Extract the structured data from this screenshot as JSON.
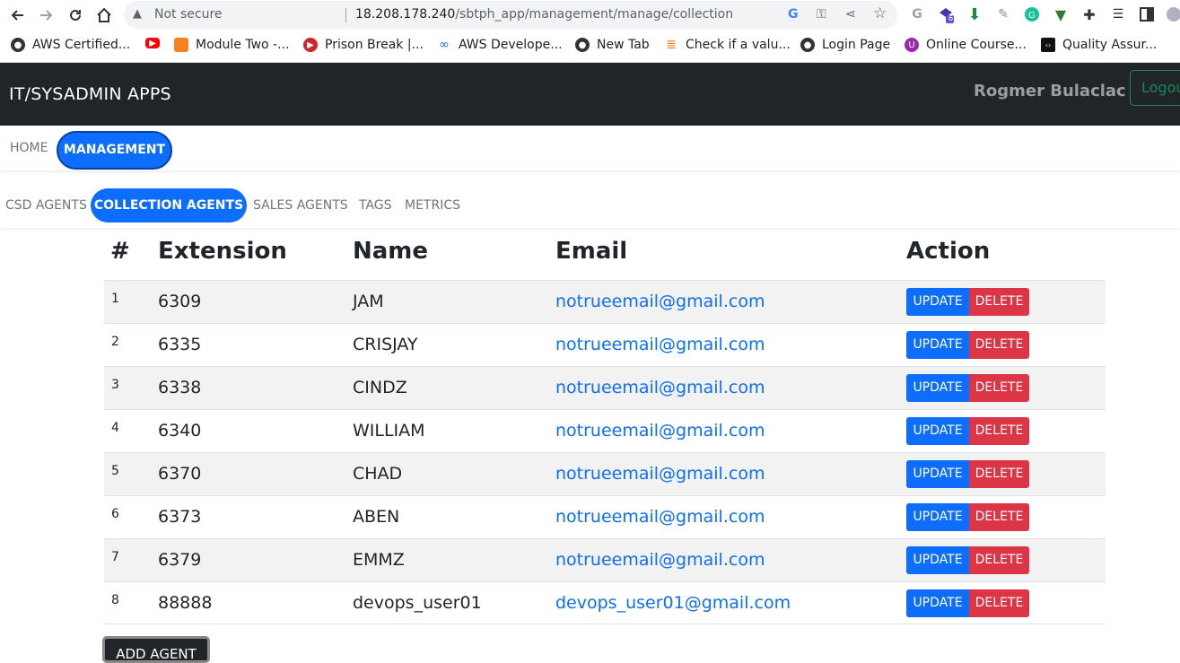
{
  "browser": {
    "security_label": "Not secure",
    "url_host": "18.208.178.240",
    "url_path": "/sbtph_app/management/manage/collection",
    "ext_badge": "6",
    "bookmarks": [
      {
        "label": "AWS Certified...",
        "color": "#333333"
      },
      {
        "label": "",
        "color": "#ff0000"
      },
      {
        "label": "Module Two -...",
        "color": "#f5821f"
      },
      {
        "label": "Prison Break |...",
        "color": "#d3242a"
      },
      {
        "label": "AWS Develope...",
        "color": "#1f6fb8"
      },
      {
        "label": "New Tab",
        "color": "#333333"
      },
      {
        "label": "Check if a valu...",
        "color": "#f48024"
      },
      {
        "label": "Login Page",
        "color": "#333333"
      },
      {
        "label": "Online Course...",
        "color": "#9c27b0"
      },
      {
        "label": "Quality Assur...",
        "color": "#111111"
      }
    ]
  },
  "app": {
    "brand": "IT/SYSADMIN APPS",
    "user": "Rogmer Bulaclac",
    "logout_label": "Logout"
  },
  "main_nav": {
    "home": "HOME",
    "management": "MANAGEMENT"
  },
  "sub_nav": {
    "csd": "CSD AGENTS",
    "collection": "COLLECTION AGENTS",
    "sales": "SALES AGENTS",
    "tags": "TAGS",
    "metrics": "METRICS"
  },
  "table": {
    "headers": {
      "num": "#",
      "ext": "Extension",
      "name": "Name",
      "email": "Email",
      "action": "Action"
    },
    "update_label": "UPDATE",
    "delete_label": "DELETE",
    "rows": [
      {
        "num": "1",
        "ext": "6309",
        "name": "JAM",
        "email": "notrueemail@gmail.com"
      },
      {
        "num": "2",
        "ext": "6335",
        "name": "CRISJAY",
        "email": "notrueemail@gmail.com"
      },
      {
        "num": "3",
        "ext": "6338",
        "name": "CINDZ",
        "email": "notrueemail@gmail.com"
      },
      {
        "num": "4",
        "ext": "6340",
        "name": "WILLIAM",
        "email": "notrueemail@gmail.com"
      },
      {
        "num": "5",
        "ext": "6370",
        "name": "CHAD",
        "email": "notrueemail@gmail.com"
      },
      {
        "num": "6",
        "ext": "6373",
        "name": "ABEN",
        "email": "notrueemail@gmail.com"
      },
      {
        "num": "7",
        "ext": "6379",
        "name": "EMMZ",
        "email": "notrueemail@gmail.com"
      },
      {
        "num": "8",
        "ext": "88888",
        "name": "devops_user01",
        "email": "devops_user01@gmail.com"
      }
    ]
  },
  "add_agent_label": "ADD AGENT",
  "colors": {
    "primary": "#0d6efd",
    "danger": "#dc3545",
    "dark": "#212529",
    "success": "#198754"
  }
}
